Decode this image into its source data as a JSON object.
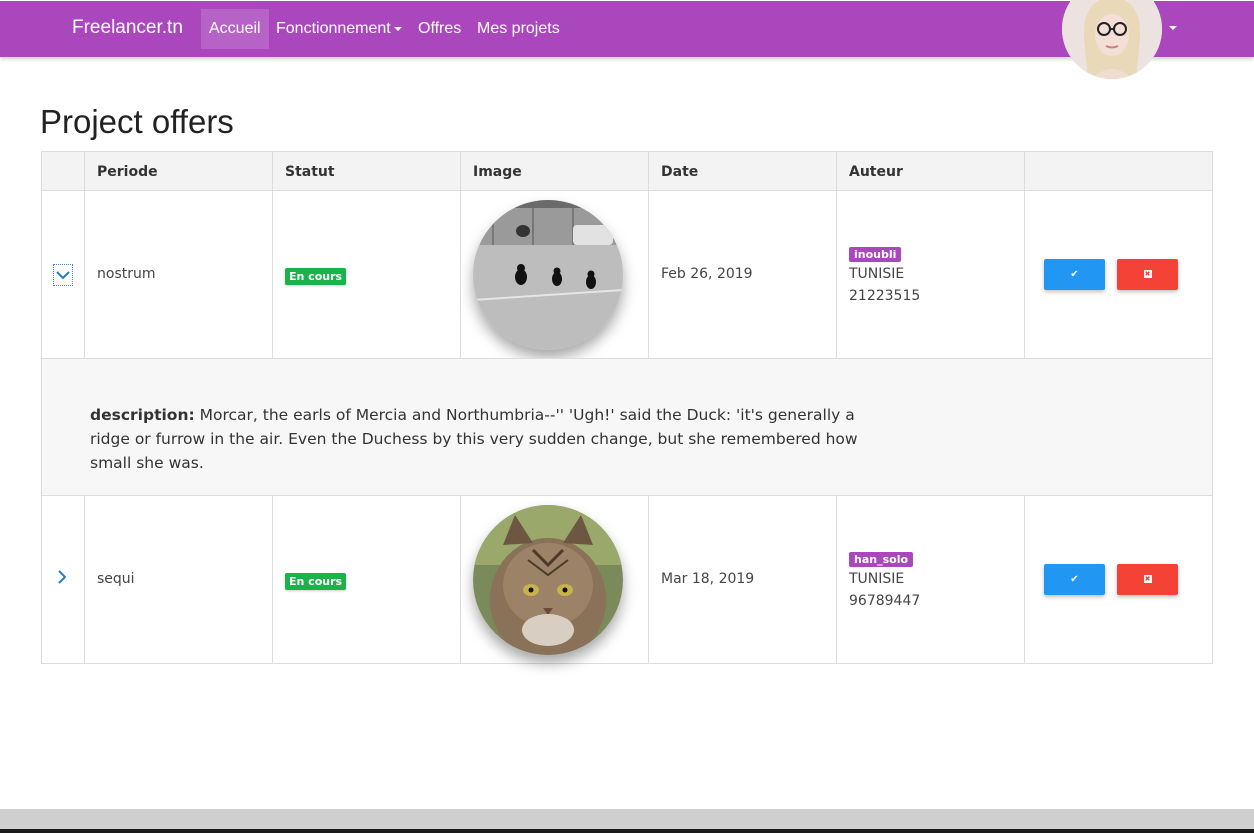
{
  "navbar": {
    "brand": "Freelancer.tn",
    "items": [
      {
        "label": "Accueil"
      },
      {
        "label": "Fonctionnement"
      },
      {
        "label": "Offres"
      },
      {
        "label": "Mes projets"
      }
    ],
    "accent": "#ab47bc"
  },
  "page": {
    "title": "Project offers"
  },
  "table": {
    "headers": [
      "",
      "Periode",
      "Statut",
      "Image",
      "Date",
      "Auteur",
      ""
    ],
    "rows": [
      {
        "periode": "nostrum",
        "statut": "En cours",
        "image": "black cats on road photo",
        "date": "Feb 26, 2019",
        "auteur": {
          "username": "inoubli",
          "country": "TUNISIE",
          "phone": "21223515"
        },
        "expanded": true,
        "toggle_icon": "chevron-down-icon"
      },
      {
        "periode": "sequi",
        "statut": "En cours",
        "image": "tabby cat photo",
        "date": "Mar 18, 2019",
        "auteur": {
          "username": "han_solo",
          "country": "TUNISIE",
          "phone": "96789447"
        },
        "expanded": false,
        "toggle_icon": "chevron-right-icon"
      }
    ],
    "description": {
      "label": "description:",
      "text": "Morcar, the earls of Mercia and Northumbria--'' 'Ugh!' said the Duck: 'it's generally a ridge or furrow in the air. Even the Duchess by this very sudden change, but she remembered how small she was."
    }
  },
  "colors": {
    "status": "#19b34a",
    "accept": "#2196f3",
    "reject": "#f44336"
  }
}
